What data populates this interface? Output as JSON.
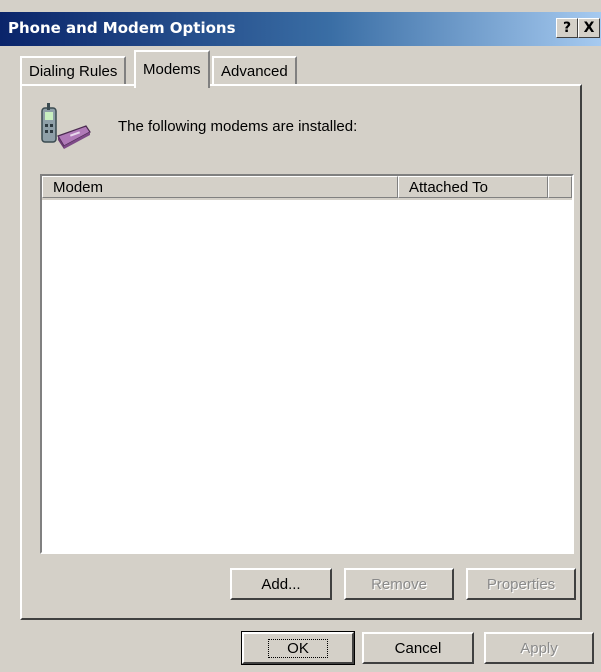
{
  "window": {
    "title": "Phone and Modem Options",
    "help_label": "?",
    "close_label": "X"
  },
  "tabs": [
    {
      "label": "Dialing Rules",
      "active": false
    },
    {
      "label": "Modems",
      "active": true
    },
    {
      "label": "Advanced",
      "active": false
    }
  ],
  "modems_page": {
    "icon": "phone-modem-icon",
    "installed_text": "The following modems are  installed:",
    "columns": [
      "Modem",
      "Attached To",
      ""
    ],
    "rows": [],
    "add_label": "Add...",
    "remove_label": "Remove",
    "properties_label": "Properties"
  },
  "footer": {
    "ok_label": "OK",
    "cancel_label": "Cancel",
    "apply_label": "Apply"
  }
}
